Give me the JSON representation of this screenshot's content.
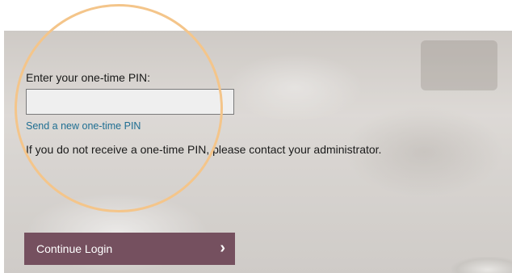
{
  "pin_form": {
    "label": "Enter your one-time PIN:",
    "input_value": "",
    "new_pin_link": "Send a new one-time PIN",
    "info_text": "If you do not receive a one-time PIN, please contact your administrator."
  },
  "actions": {
    "continue_label": "Continue Login",
    "continue_icon": "›"
  },
  "colors": {
    "button": "#75505f",
    "link": "#1f6e92",
    "highlight_ring": "#f4c58a"
  }
}
